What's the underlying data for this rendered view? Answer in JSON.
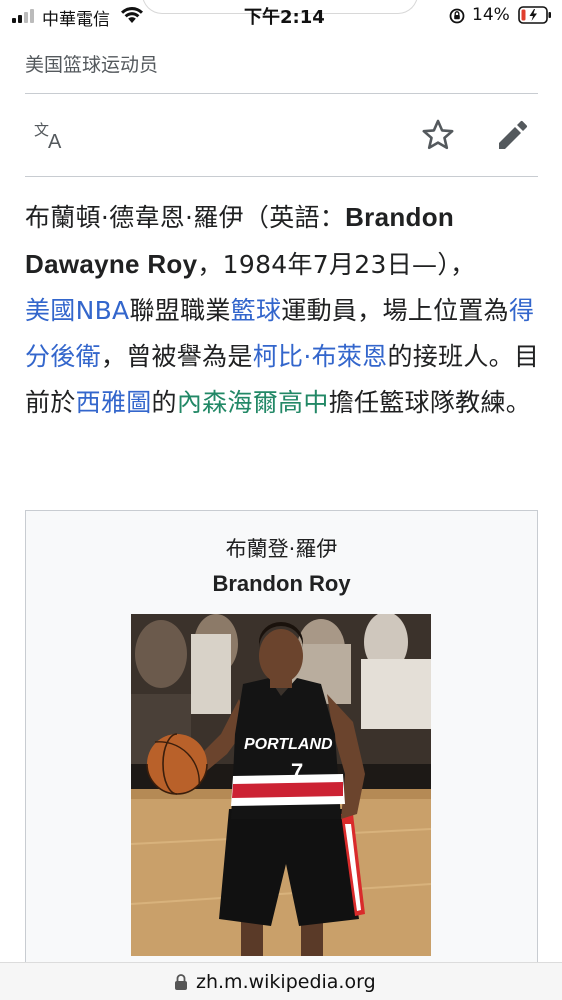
{
  "status_bar": {
    "carrier": "中華電信",
    "time": "下午2:14",
    "battery": "14%"
  },
  "article": {
    "short_description": "美国篮球运动员",
    "actions": {
      "language": "language-icon",
      "watch": "star-icon",
      "edit": "pencil-icon"
    },
    "intro": {
      "name_zh": "布蘭頓·德韋恩·羅伊（英語：",
      "name_en": "Brandon Dawayne Roy",
      "birth": "，1984年7月23日—），",
      "link_usa_nba": "美國NBA",
      "text_league": "聯盟職業",
      "link_basketball": "籃球",
      "text_player": "運動員，場上位置為",
      "link_shooting_guard": "得分後衛",
      "text_praised": "，曾被譽為是",
      "link_kobe": "柯比·布萊恩",
      "text_successor": "的接班人。目前於",
      "link_seattle": "西雅圖",
      "text_of": "的",
      "link_school": "內森海爾高中",
      "text_coach": "擔任籃球隊教練。"
    },
    "infobox": {
      "name_zh": "布蘭登·羅伊",
      "name_en": "Brandon Roy",
      "photo": {
        "jersey_text": "PORTLAND",
        "jersey_number": "7"
      }
    }
  },
  "url_bar": {
    "url": "zh.m.wikipedia.org"
  },
  "colors": {
    "link": "#3366cc",
    "link_visited_alt": "#228866",
    "text": "#202122",
    "muted": "#54595d",
    "border": "#c8ccd1",
    "infobox_bg": "#f8f9fa"
  }
}
